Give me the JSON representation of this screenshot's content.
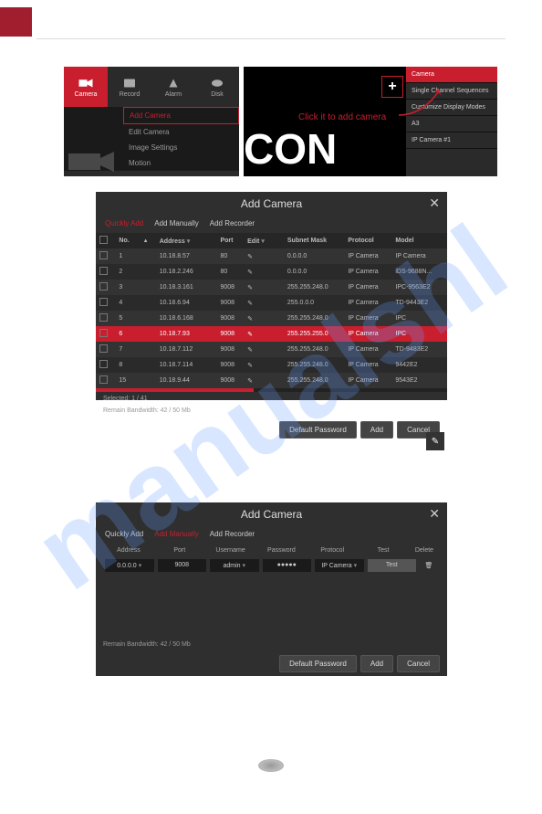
{
  "watermark_text": "manualshl",
  "menu": {
    "icons": [
      {
        "label": "Camera",
        "name": "camera-icon"
      },
      {
        "label": "Record",
        "name": "record-icon"
      },
      {
        "label": "Alarm",
        "name": "alarm-icon"
      },
      {
        "label": "Disk",
        "name": "disk-icon"
      }
    ],
    "items": [
      {
        "label": "Add Camera",
        "highlight": true
      },
      {
        "label": "Edit Camera",
        "highlight": false
      },
      {
        "label": "Image Settings",
        "highlight": false
      },
      {
        "label": "Motion",
        "highlight": false
      }
    ]
  },
  "ctx": {
    "con": "CON",
    "click_hint": "Click it to add camera",
    "plus": "+",
    "items": [
      {
        "label": "Camera",
        "active": true
      },
      {
        "label": "Single Channel Sequences",
        "active": false
      },
      {
        "label": "Customize Display Modes",
        "active": false
      },
      {
        "label": "A3",
        "active": false
      },
      {
        "label": "IP Camera #1",
        "active": false
      }
    ]
  },
  "dlg1": {
    "title": "Add Camera",
    "close": "✕",
    "tabs": [
      "Quickly Add",
      "Add Manually",
      "Add Recorder"
    ],
    "active_tab": 0,
    "headers": [
      "",
      "No.",
      "",
      "Address",
      "",
      "Port",
      "Edit",
      "",
      "Subnet Mask",
      "Protocol",
      "Model"
    ],
    "rows": [
      {
        "sel": false,
        "no": "1",
        "addr": "10.18.8.57",
        "port": "80",
        "mask": "0.0.0.0",
        "proto": "IP Camera",
        "model": "IP Camera"
      },
      {
        "sel": false,
        "no": "2",
        "addr": "10.18.2.246",
        "port": "80",
        "mask": "0.0.0.0",
        "proto": "IP Camera",
        "model": "iDS-9688N..."
      },
      {
        "sel": false,
        "no": "3",
        "addr": "10.18.3.161",
        "port": "9008",
        "mask": "255.255.248.0",
        "proto": "IP Camera",
        "model": "IPC-9563E2"
      },
      {
        "sel": false,
        "no": "4",
        "addr": "10.18.6.94",
        "port": "9008",
        "mask": "255.0.0.0",
        "proto": "IP Camera",
        "model": "TD-9443E2"
      },
      {
        "sel": false,
        "no": "5",
        "addr": "10.18.6.168",
        "port": "9008",
        "mask": "255.255.248.0",
        "proto": "IP Camera",
        "model": "IPC"
      },
      {
        "sel": true,
        "no": "6",
        "addr": "10.18.7.93",
        "port": "9008",
        "mask": "255.255.255.0",
        "proto": "IP Camera",
        "model": "IPC"
      },
      {
        "sel": false,
        "no": "7",
        "addr": "10.18.7.112",
        "port": "9008",
        "mask": "255.255.248.0",
        "proto": "IP Camera",
        "model": "TD-9483E2"
      },
      {
        "sel": false,
        "no": "8",
        "addr": "10.18.7.114",
        "port": "9008",
        "mask": "255.255.248.0",
        "proto": "IP Camera",
        "model": "9442E2"
      },
      {
        "sel": false,
        "no": "15",
        "addr": "10.18.9.44",
        "port": "9008",
        "mask": "255.255.248.0",
        "proto": "IP Camera",
        "model": "9543E2"
      }
    ],
    "selected": "Selected: 1 / 41",
    "remain": "Remain Bandwidth: 42 / 50 Mb",
    "buttons": [
      "Default Password",
      "Add",
      "Cancel"
    ]
  },
  "edit_icon": "✎",
  "dlg2": {
    "title": "Add Camera",
    "close": "✕",
    "tabs": [
      "Quickly Add",
      "Add Manually",
      "Add Recorder"
    ],
    "active_tab": 1,
    "headers": [
      "Address",
      "Port",
      "Username",
      "Password",
      "Protocol",
      "Test",
      "Delete"
    ],
    "row": {
      "addr": "0.0.0.0",
      "port": "9008",
      "user": "admin",
      "pass": "●●●●●",
      "proto": "IP Camera",
      "test": "Test",
      "del": "🗑"
    },
    "remain": "Remain Bandwidth: 42 / 50 Mb",
    "buttons": [
      "Default Password",
      "Add",
      "Cancel"
    ]
  }
}
